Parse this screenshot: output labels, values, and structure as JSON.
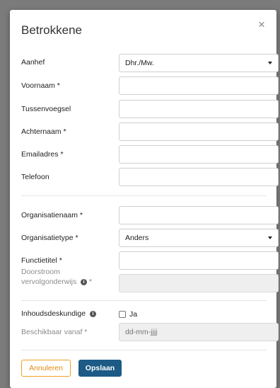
{
  "dialog": {
    "title": "Betrokkene",
    "close_glyph": "×"
  },
  "fields": {
    "aanhef": {
      "label": "Aanhef",
      "value": "Dhr./Mw."
    },
    "voornaam": {
      "label": "Voornaam *",
      "value": ""
    },
    "tussenvoegsel": {
      "label": "Tussenvoegsel",
      "value": ""
    },
    "achternaam": {
      "label": "Achternaam *",
      "value": ""
    },
    "emailadres": {
      "label": "Emailadres *",
      "value": ""
    },
    "telefoon": {
      "label": "Telefoon",
      "value": ""
    },
    "organisatienaam": {
      "label": "Organisatienaam *",
      "value": ""
    },
    "organisatietype": {
      "label": "Organisatietype *",
      "value": "Anders"
    },
    "functietitel": {
      "label": "Functietitel *",
      "value": ""
    },
    "doorstroom": {
      "label_line1": "Doorstroom",
      "label_line2": "vervolgonderwijs",
      "required_mark": "*",
      "value": ""
    },
    "inhoudsdeskundige": {
      "label": "Inhoudsdeskundige",
      "checkbox_label": "Ja",
      "checked": false
    },
    "beschikbaar_vanaf": {
      "label": "Beschikbaar vanaf *",
      "placeholder": "dd-mm-jjjj"
    }
  },
  "icons": {
    "info": "info-icon",
    "close": "close-icon",
    "caret": "caret-down-icon"
  },
  "buttons": {
    "cancel": "Annuleren",
    "save": "Opslaan"
  },
  "colors": {
    "cancel_border": "#f0a020",
    "save_bg": "#1d5a85"
  }
}
